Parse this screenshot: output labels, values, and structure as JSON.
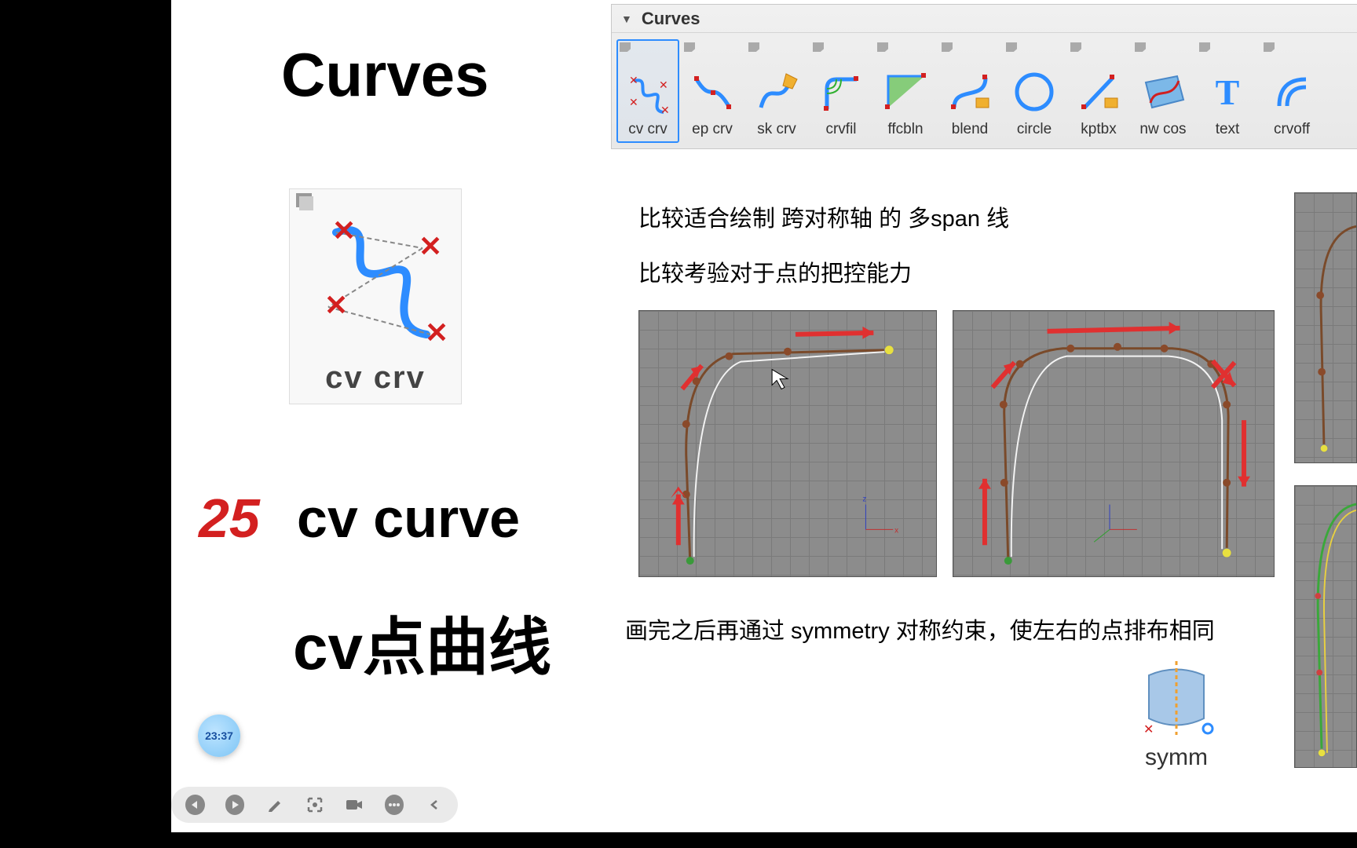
{
  "title": "Curves",
  "big_icon_label": "cv crv",
  "topic": {
    "number": "25",
    "name_en": "cv curve",
    "name_ch": "cv点曲线"
  },
  "toolbar": {
    "title": "Curves",
    "items": [
      {
        "label": "cv crv",
        "icon": "cv-crv-icon",
        "selected": true
      },
      {
        "label": "ep crv",
        "icon": "ep-crv-icon",
        "selected": false
      },
      {
        "label": "sk crv",
        "icon": "sk-crv-icon",
        "selected": false
      },
      {
        "label": "crvfil",
        "icon": "crvfil-icon",
        "selected": false
      },
      {
        "label": "ffcbln",
        "icon": "ffcbln-icon",
        "selected": false
      },
      {
        "label": "blend",
        "icon": "blend-icon",
        "selected": false
      },
      {
        "label": "circle",
        "icon": "circle-icon",
        "selected": false
      },
      {
        "label": "kptbx",
        "icon": "kptbx-icon",
        "selected": false
      },
      {
        "label": "nw cos",
        "icon": "nw-cos-icon",
        "selected": false
      },
      {
        "label": "text",
        "icon": "text-icon",
        "selected": false
      },
      {
        "label": "crvoff",
        "icon": "crvoff-icon",
        "selected": false
      }
    ]
  },
  "descriptions": {
    "line1": "比较适合绘制 跨对称轴 的 多span 线",
    "line2": "比较考验对于点的把控能力",
    "line3": "画完之后再通过 symmetry 对称约束，使左右的点排布相同"
  },
  "symm_label": "symm",
  "clock_time": "23:37"
}
